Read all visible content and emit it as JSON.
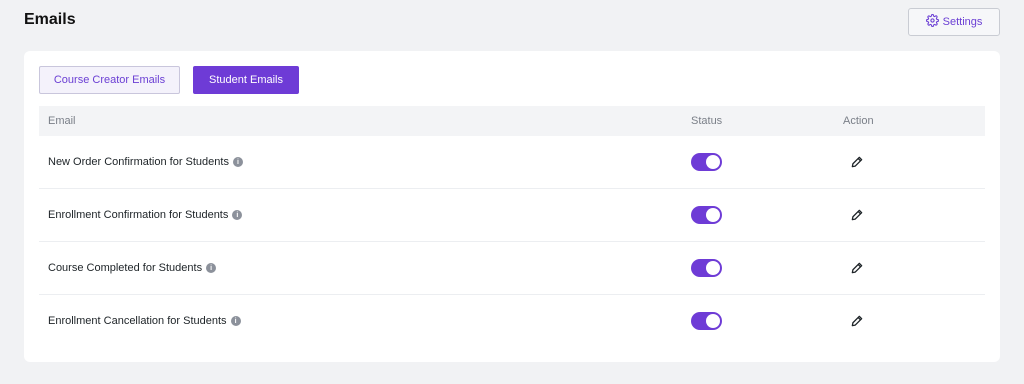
{
  "header": {
    "title": "Emails",
    "settings_label": "Settings"
  },
  "tabs": [
    {
      "label": "Course Creator Emails",
      "active": false
    },
    {
      "label": "Student Emails",
      "active": true
    }
  ],
  "table": {
    "columns": {
      "email": "Email",
      "status": "Status",
      "action": "Action"
    },
    "rows": [
      {
        "email": "New Order Confirmation for Students",
        "enabled": true
      },
      {
        "email": "Enrollment Confirmation for Students",
        "enabled": true
      },
      {
        "email": "Course Completed for Students",
        "enabled": true
      },
      {
        "email": "Enrollment Cancellation for Students",
        "enabled": true
      }
    ]
  },
  "icons": {
    "settings": "gear-icon",
    "info": "info-icon",
    "edit": "pencil-icon"
  },
  "colors": {
    "accent": "#6e3bd6",
    "background": "#f1f2f4"
  }
}
